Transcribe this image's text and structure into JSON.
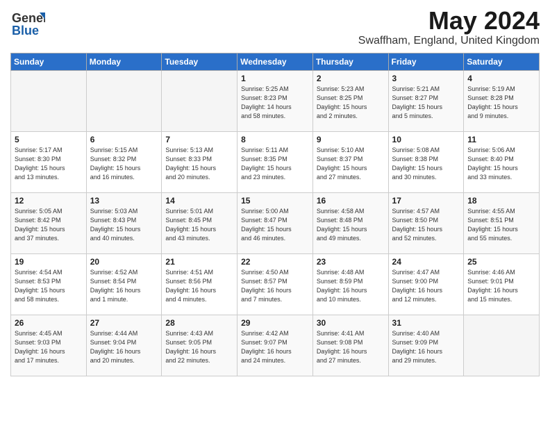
{
  "header": {
    "logo_general": "General",
    "logo_blue": "Blue",
    "main_title": "May 2024",
    "subtitle": "Swaffham, England, United Kingdom"
  },
  "calendar": {
    "headers": [
      "Sunday",
      "Monday",
      "Tuesday",
      "Wednesday",
      "Thursday",
      "Friday",
      "Saturday"
    ],
    "weeks": [
      [
        {
          "day": "",
          "info": ""
        },
        {
          "day": "",
          "info": ""
        },
        {
          "day": "",
          "info": ""
        },
        {
          "day": "1",
          "info": "Sunrise: 5:25 AM\nSunset: 8:23 PM\nDaylight: 14 hours\nand 58 minutes."
        },
        {
          "day": "2",
          "info": "Sunrise: 5:23 AM\nSunset: 8:25 PM\nDaylight: 15 hours\nand 2 minutes."
        },
        {
          "day": "3",
          "info": "Sunrise: 5:21 AM\nSunset: 8:27 PM\nDaylight: 15 hours\nand 5 minutes."
        },
        {
          "day": "4",
          "info": "Sunrise: 5:19 AM\nSunset: 8:28 PM\nDaylight: 15 hours\nand 9 minutes."
        }
      ],
      [
        {
          "day": "5",
          "info": "Sunrise: 5:17 AM\nSunset: 8:30 PM\nDaylight: 15 hours\nand 13 minutes."
        },
        {
          "day": "6",
          "info": "Sunrise: 5:15 AM\nSunset: 8:32 PM\nDaylight: 15 hours\nand 16 minutes."
        },
        {
          "day": "7",
          "info": "Sunrise: 5:13 AM\nSunset: 8:33 PM\nDaylight: 15 hours\nand 20 minutes."
        },
        {
          "day": "8",
          "info": "Sunrise: 5:11 AM\nSunset: 8:35 PM\nDaylight: 15 hours\nand 23 minutes."
        },
        {
          "day": "9",
          "info": "Sunrise: 5:10 AM\nSunset: 8:37 PM\nDaylight: 15 hours\nand 27 minutes."
        },
        {
          "day": "10",
          "info": "Sunrise: 5:08 AM\nSunset: 8:38 PM\nDaylight: 15 hours\nand 30 minutes."
        },
        {
          "day": "11",
          "info": "Sunrise: 5:06 AM\nSunset: 8:40 PM\nDaylight: 15 hours\nand 33 minutes."
        }
      ],
      [
        {
          "day": "12",
          "info": "Sunrise: 5:05 AM\nSunset: 8:42 PM\nDaylight: 15 hours\nand 37 minutes."
        },
        {
          "day": "13",
          "info": "Sunrise: 5:03 AM\nSunset: 8:43 PM\nDaylight: 15 hours\nand 40 minutes."
        },
        {
          "day": "14",
          "info": "Sunrise: 5:01 AM\nSunset: 8:45 PM\nDaylight: 15 hours\nand 43 minutes."
        },
        {
          "day": "15",
          "info": "Sunrise: 5:00 AM\nSunset: 8:47 PM\nDaylight: 15 hours\nand 46 minutes."
        },
        {
          "day": "16",
          "info": "Sunrise: 4:58 AM\nSunset: 8:48 PM\nDaylight: 15 hours\nand 49 minutes."
        },
        {
          "day": "17",
          "info": "Sunrise: 4:57 AM\nSunset: 8:50 PM\nDaylight: 15 hours\nand 52 minutes."
        },
        {
          "day": "18",
          "info": "Sunrise: 4:55 AM\nSunset: 8:51 PM\nDaylight: 15 hours\nand 55 minutes."
        }
      ],
      [
        {
          "day": "19",
          "info": "Sunrise: 4:54 AM\nSunset: 8:53 PM\nDaylight: 15 hours\nand 58 minutes."
        },
        {
          "day": "20",
          "info": "Sunrise: 4:52 AM\nSunset: 8:54 PM\nDaylight: 16 hours\nand 1 minute."
        },
        {
          "day": "21",
          "info": "Sunrise: 4:51 AM\nSunset: 8:56 PM\nDaylight: 16 hours\nand 4 minutes."
        },
        {
          "day": "22",
          "info": "Sunrise: 4:50 AM\nSunset: 8:57 PM\nDaylight: 16 hours\nand 7 minutes."
        },
        {
          "day": "23",
          "info": "Sunrise: 4:48 AM\nSunset: 8:59 PM\nDaylight: 16 hours\nand 10 minutes."
        },
        {
          "day": "24",
          "info": "Sunrise: 4:47 AM\nSunset: 9:00 PM\nDaylight: 16 hours\nand 12 minutes."
        },
        {
          "day": "25",
          "info": "Sunrise: 4:46 AM\nSunset: 9:01 PM\nDaylight: 16 hours\nand 15 minutes."
        }
      ],
      [
        {
          "day": "26",
          "info": "Sunrise: 4:45 AM\nSunset: 9:03 PM\nDaylight: 16 hours\nand 17 minutes."
        },
        {
          "day": "27",
          "info": "Sunrise: 4:44 AM\nSunset: 9:04 PM\nDaylight: 16 hours\nand 20 minutes."
        },
        {
          "day": "28",
          "info": "Sunrise: 4:43 AM\nSunset: 9:05 PM\nDaylight: 16 hours\nand 22 minutes."
        },
        {
          "day": "29",
          "info": "Sunrise: 4:42 AM\nSunset: 9:07 PM\nDaylight: 16 hours\nand 24 minutes."
        },
        {
          "day": "30",
          "info": "Sunrise: 4:41 AM\nSunset: 9:08 PM\nDaylight: 16 hours\nand 27 minutes."
        },
        {
          "day": "31",
          "info": "Sunrise: 4:40 AM\nSunset: 9:09 PM\nDaylight: 16 hours\nand 29 minutes."
        },
        {
          "day": "",
          "info": ""
        }
      ]
    ]
  }
}
